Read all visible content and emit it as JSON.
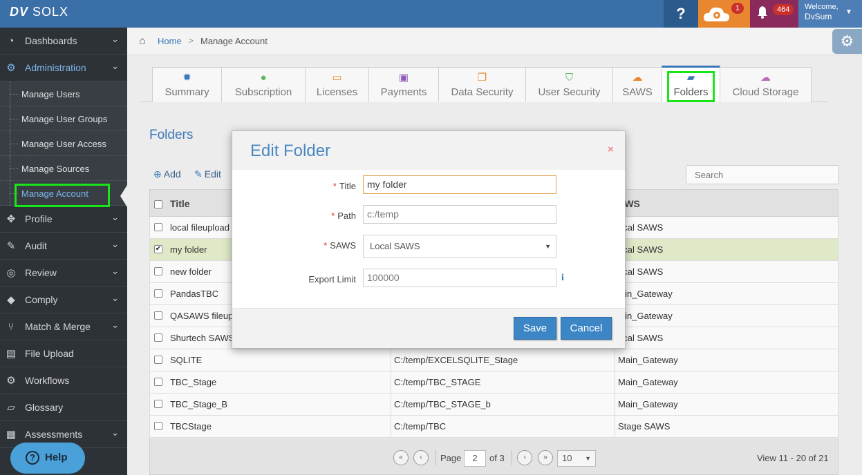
{
  "app": {
    "logo_dv": "DV",
    "logo_name": "SOLX",
    "help_glyph": "?",
    "cloud_badge": "1",
    "notifications_badge": "464",
    "welcome_line1": "Welcome,",
    "welcome_user": "DvSum"
  },
  "sidebar": {
    "items": [
      {
        "label": "Dashboards",
        "icon": "dashboard-icon"
      },
      {
        "label": "Administration",
        "icon": "gears-icon"
      },
      {
        "label": "Profile",
        "icon": "crosshair-icon"
      },
      {
        "label": "Audit",
        "icon": "edit-icon"
      },
      {
        "label": "Review",
        "icon": "target-icon"
      },
      {
        "label": "Comply",
        "icon": "tags-icon"
      },
      {
        "label": "Match & Merge",
        "icon": "branch-icon"
      },
      {
        "label": "File Upload",
        "icon": "file-icon"
      },
      {
        "label": "Workflows",
        "icon": "workflow-icon"
      },
      {
        "label": "Glossary",
        "icon": "book-icon"
      },
      {
        "label": "Assessments",
        "icon": "clipboard-icon"
      }
    ],
    "sub_items": [
      {
        "label": "Manage Users"
      },
      {
        "label": "Manage User Groups"
      },
      {
        "label": "Manage User Access"
      },
      {
        "label": "Manage Sources"
      },
      {
        "label": "Manage Account"
      }
    ],
    "help_label": "Help"
  },
  "breadcrumb": {
    "home": "Home",
    "separator": ">",
    "current": "Manage Account"
  },
  "tabs": [
    {
      "label": "Summary",
      "icon": "sun-icon",
      "color": "#3a77b8"
    },
    {
      "label": "Subscription",
      "icon": "user-icon",
      "color": "#5cb85c"
    },
    {
      "label": "Licenses",
      "icon": "card-icon",
      "color": "#e8872f"
    },
    {
      "label": "Payments",
      "icon": "money-icon",
      "color": "#8e5cb8"
    },
    {
      "label": "Data Security",
      "icon": "copy-icon",
      "color": "#e8872f"
    },
    {
      "label": "User Security",
      "icon": "shield-icon",
      "color": "#5cb85c"
    },
    {
      "label": "SAWS",
      "icon": "cloud-gear-icon",
      "color": "#e8872f"
    },
    {
      "label": "Folders",
      "icon": "folder-open-icon",
      "color": "#3a77b8"
    },
    {
      "label": "Cloud Storage",
      "icon": "cloud-icon",
      "color": "#b86cb8"
    }
  ],
  "folders": {
    "title": "Folders",
    "add_label": "Add",
    "edit_label": "Edit",
    "search_placeholder": "Search",
    "columns": {
      "title": "Title",
      "saws": "AWS"
    },
    "rows": [
      {
        "title": "local fileupload",
        "path": "",
        "saws": "ocal SAWS",
        "checked": false
      },
      {
        "title": "my folder",
        "path": "",
        "saws": "ocal SAWS",
        "checked": true
      },
      {
        "title": "new folder",
        "path": "",
        "saws": "ocal SAWS",
        "checked": false
      },
      {
        "title": "PandasTBC",
        "path": "",
        "saws": "lain_Gateway",
        "checked": false
      },
      {
        "title": "QASAWS fileup",
        "path": "",
        "saws": "lain_Gateway",
        "checked": false
      },
      {
        "title": "Shurtech SAWS",
        "path": "",
        "saws": "ocal SAWS",
        "checked": false
      },
      {
        "title": "SQLITE",
        "path": "C:/temp/EXCELSQLITE_Stage",
        "saws": "Main_Gateway",
        "checked": false
      },
      {
        "title": "TBC_Stage",
        "path": "C:/temp/TBC_STAGE",
        "saws": "Main_Gateway",
        "checked": false
      },
      {
        "title": "TBC_Stage_B",
        "path": "C:/temp/TBC_STAGE_b",
        "saws": "Main_Gateway",
        "checked": false
      },
      {
        "title": "TBCStage",
        "path": "C:/temp/TBC",
        "saws": "Stage SAWS",
        "checked": false
      }
    ],
    "pager": {
      "page_label": "Page",
      "page_value": "2",
      "of_label": "of 3",
      "page_size": "10",
      "view_text": "View 11 - 20 of 21"
    }
  },
  "modal": {
    "title": "Edit Folder",
    "close": "×",
    "fields": {
      "title_label": "Title",
      "title_value": "my folder",
      "path_label": "Path",
      "path_value": "c:/temp",
      "saws_label": "SAWS",
      "saws_value": "Local SAWS",
      "export_label": "Export Limit",
      "export_value": "100000"
    },
    "required_mark": "*",
    "info_glyph": "i",
    "save_label": "Save",
    "cancel_label": "Cancel"
  }
}
